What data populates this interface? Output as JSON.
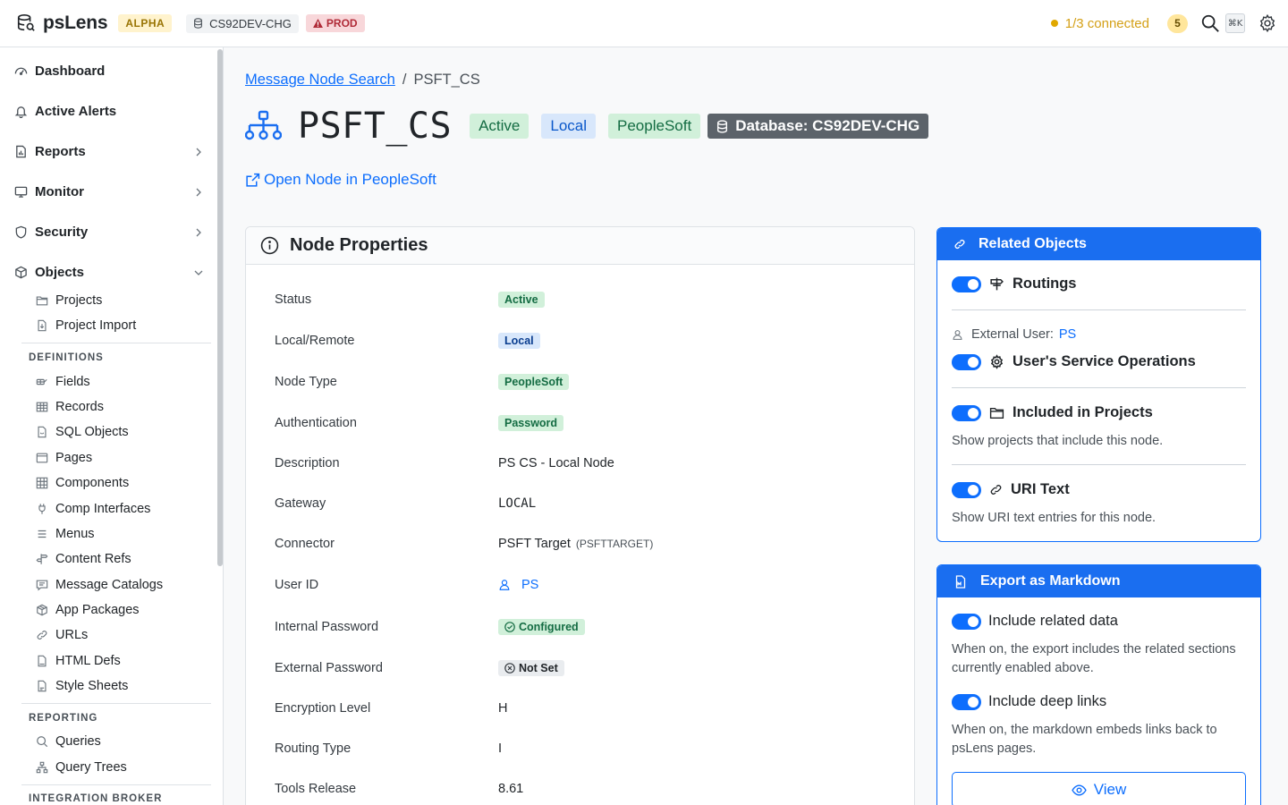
{
  "app": {
    "name": "psLens",
    "stage_badge": "ALPHA",
    "database": "CS92DEV-CHG",
    "env_badge": "PROD",
    "connection_status": "1/3 connected",
    "notification_count": "5",
    "shortcut": "⌘K",
    "colors": {
      "primary": "#0d6efd",
      "connected_warning": "#e0a800",
      "active_green": "#146c43"
    }
  },
  "sidebar": {
    "main_items": [
      {
        "label": "Dashboard",
        "icon": "dashboard-icon"
      },
      {
        "label": "Active Alerts",
        "icon": "bell-icon"
      },
      {
        "label": "Reports",
        "icon": "report-icon",
        "expandable": true
      },
      {
        "label": "Monitor",
        "icon": "monitor-icon",
        "expandable": true
      },
      {
        "label": "Security",
        "icon": "shield-icon",
        "expandable": true
      },
      {
        "label": "Objects",
        "icon": "cube-icon",
        "expanded": true
      }
    ],
    "object_items": [
      {
        "label": "Projects",
        "icon": "folder-icon"
      },
      {
        "label": "Project Import",
        "icon": "file-import-icon"
      }
    ],
    "definitions_heading": "DEFINITIONS",
    "definition_items": [
      {
        "label": "Fields",
        "icon": "field-icon"
      },
      {
        "label": "Records",
        "icon": "table-icon"
      },
      {
        "label": "SQL Objects",
        "icon": "sql-file-icon"
      },
      {
        "label": "Pages",
        "icon": "page-icon"
      },
      {
        "label": "Components",
        "icon": "grid-icon"
      },
      {
        "label": "Comp Interfaces",
        "icon": "plug-icon"
      },
      {
        "label": "Menus",
        "icon": "menu-icon"
      },
      {
        "label": "Content Refs",
        "icon": "signpost-icon"
      },
      {
        "label": "Message Catalogs",
        "icon": "message-icon"
      },
      {
        "label": "App Packages",
        "icon": "package-icon"
      },
      {
        "label": "URLs",
        "icon": "link-icon"
      },
      {
        "label": "HTML Defs",
        "icon": "html-file-icon"
      },
      {
        "label": "Style Sheets",
        "icon": "css-file-icon"
      }
    ],
    "reporting_heading": "REPORTING",
    "reporting_items": [
      {
        "label": "Queries",
        "icon": "search-icon"
      },
      {
        "label": "Query Trees",
        "icon": "tree-icon"
      }
    ],
    "integration_heading": "INTEGRATION BROKER"
  },
  "breadcrumb": {
    "parent": "Message Node Search",
    "separator": "/",
    "current": "PSFT_CS"
  },
  "header": {
    "title": "PSFT_CS",
    "tags": [
      "Active",
      "Local",
      "PeopleSoft"
    ],
    "database_tag": "Database: CS92DEV-CHG",
    "open_link": "Open Node in PeopleSoft"
  },
  "properties": {
    "title": "Node Properties",
    "rows": {
      "status": {
        "label": "Status",
        "value": "Active"
      },
      "local_remote": {
        "label": "Local/Remote",
        "value": "Local"
      },
      "node_type": {
        "label": "Node Type",
        "value": "PeopleSoft"
      },
      "authentication": {
        "label": "Authentication",
        "value": "Password"
      },
      "description": {
        "label": "Description",
        "value": "PS CS - Local Node"
      },
      "gateway": {
        "label": "Gateway",
        "value": "LOCAL"
      },
      "connector": {
        "label": "Connector",
        "value": "PSFT Target",
        "sub": "(PSFTTARGET)"
      },
      "user_id": {
        "label": "User ID",
        "value": "PS"
      },
      "internal_password": {
        "label": "Internal Password",
        "value": "Configured"
      },
      "external_password": {
        "label": "External Password",
        "value": "Not Set"
      },
      "encryption_level": {
        "label": "Encryption Level",
        "value": "H"
      },
      "routing_type": {
        "label": "Routing Type",
        "value": "I"
      },
      "tools_release": {
        "label": "Tools Release",
        "value": "8.61"
      }
    }
  },
  "related": {
    "title": "Related Objects",
    "routings": "Routings",
    "external_user_label": "External User:",
    "external_user_value": "PS",
    "service_ops": "User's Service Operations",
    "projects": "Included in Projects",
    "projects_desc": "Show projects that include this node.",
    "uri_text": "URI Text",
    "uri_desc": "Show URI text entries for this node."
  },
  "export": {
    "title": "Export as Markdown",
    "include_related": "Include related data",
    "include_related_desc": "When on, the export includes the related sections currently enabled above.",
    "include_links": "Include deep links",
    "include_links_desc": "When on, the markdown embeds links back to psLens pages.",
    "view_button": "View"
  }
}
